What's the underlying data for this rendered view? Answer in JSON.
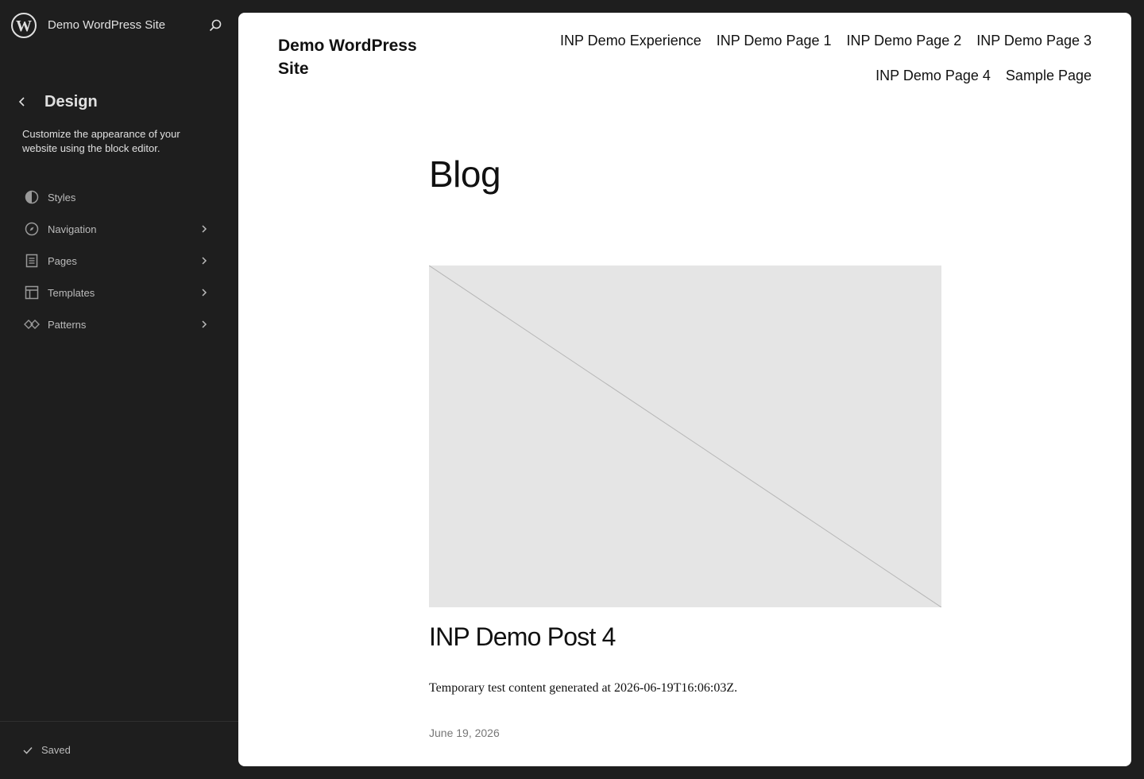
{
  "sidebar": {
    "site_name": "Demo WordPress Site",
    "section_title": "Design",
    "description": "Customize the appearance of your website using the block editor.",
    "items": [
      {
        "label": "Styles",
        "icon": "styles-icon",
        "has_chevron": false
      },
      {
        "label": "Navigation",
        "icon": "navigation-icon",
        "has_chevron": true
      },
      {
        "label": "Pages",
        "icon": "pages-icon",
        "has_chevron": true
      },
      {
        "label": "Templates",
        "icon": "templates-icon",
        "has_chevron": true
      },
      {
        "label": "Patterns",
        "icon": "patterns-icon",
        "has_chevron": true
      }
    ],
    "save_status": "Saved"
  },
  "canvas": {
    "site_title": "Demo WordPress Site",
    "nav": [
      "INP Demo Experience",
      "INP Demo Page 1",
      "INP Demo Page 2",
      "INP Demo Page 3",
      "INP Demo Page 4",
      "Sample Page"
    ],
    "page_title": "Blog",
    "post": {
      "title": "INP Demo Post 4",
      "excerpt": "Temporary test content generated at 2026-06-19T16:06:03Z.",
      "date": "June 19, 2026"
    }
  },
  "colors": {
    "sidebar_bg": "#1e1e1e",
    "canvas_bg": "#ffffff",
    "placeholder_bg": "#e5e5e5"
  }
}
